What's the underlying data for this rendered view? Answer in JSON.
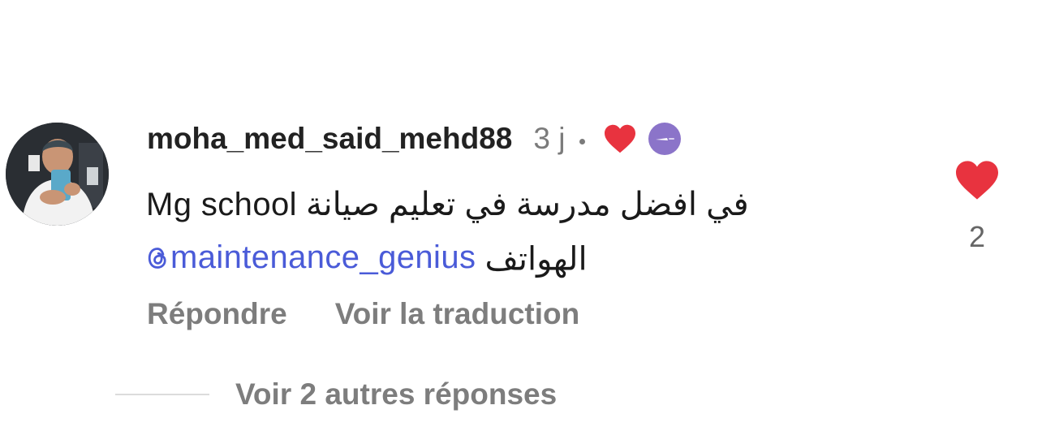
{
  "comment": {
    "username": "moha_med_said_mehd88",
    "time": "3 j",
    "text_line1": "في افضل مدرسة في تعليم صيانة Mg school",
    "mention": "maintenance_genius",
    "text_line2_after": "الهواتف",
    "reply_label": "Répondre",
    "translate_label": "Voir la traduction",
    "like_count": "2",
    "icons": {
      "creator_like": "heart-icon",
      "badge": "creator-badge-icon",
      "like": "heart-icon",
      "mention": "threads-at-icon"
    }
  },
  "replies": {
    "label": "Voir 2 autres réponses"
  },
  "colors": {
    "heart": "#e8333f",
    "mention": "#4a5bd8",
    "badge": "#8b74c9",
    "muted_text": "#7d7d7d"
  }
}
